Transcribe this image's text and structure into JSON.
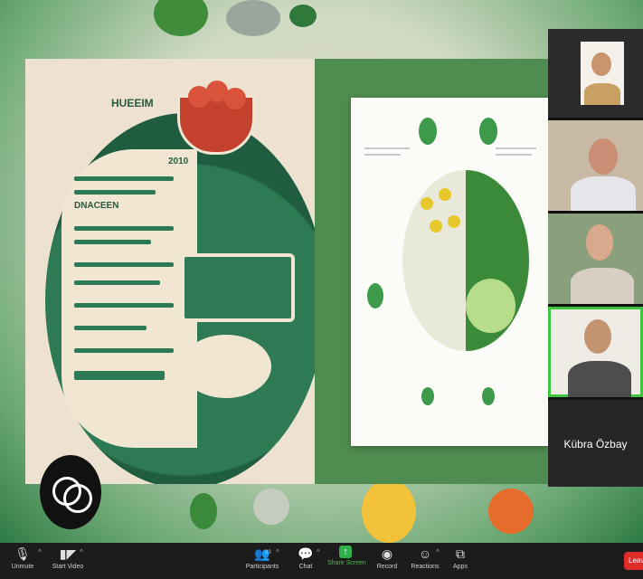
{
  "participants": {
    "active_name": "Kübra Özbay"
  },
  "slide_left": {
    "heading": "HUEEIM",
    "number": "2010",
    "subheading": "DNACEEN"
  },
  "toolbar": {
    "unmute_label": "Unmute",
    "start_video_label": "Start Video",
    "participants_label": "Participants",
    "participants_count": "33",
    "chat_label": "Chat",
    "share_screen_label": "Share Screen",
    "record_label": "Record",
    "reactions_label": "Reactions",
    "apps_label": "Apps",
    "leave_label": "Leave"
  },
  "colors": {
    "share_green": "#2db24a",
    "active_outline": "#3ec43e",
    "leave_red": "#e02b2b"
  }
}
